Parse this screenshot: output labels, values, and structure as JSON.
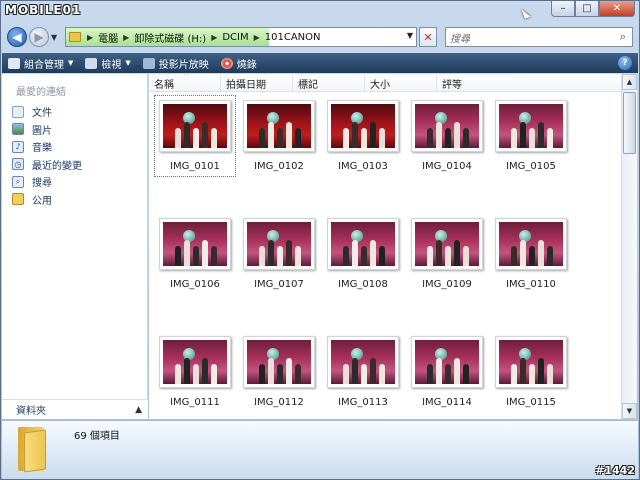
{
  "window": {
    "logo_text": "MOBILE01",
    "minimize_symbol": "–",
    "maximize_symbol": "□",
    "close_symbol": "✕"
  },
  "address": {
    "crumbs": [
      "電腦",
      "卸除式磁碟 (H:)",
      "DCIM",
      "101CANON"
    ],
    "search_placeholder": "搜尋",
    "back_symbol": "◀",
    "forward_symbol": "▶"
  },
  "toolbar": {
    "organize_label": "組合管理",
    "views_label": "檢視",
    "slideshow_label": "投影片放映",
    "burn_label": "燒錄",
    "help_symbol": "?"
  },
  "nav_pane": {
    "title": "最愛的連結",
    "items": [
      {
        "label": "文件",
        "icon": "documents-icon"
      },
      {
        "label": "圖片",
        "icon": "pictures-icon"
      },
      {
        "label": "音樂",
        "icon": "music-icon"
      },
      {
        "label": "最近的變更",
        "icon": "recent-changes-icon"
      },
      {
        "label": "搜尋",
        "icon": "searches-icon"
      },
      {
        "label": "公用",
        "icon": "public-folder-icon"
      }
    ],
    "folders_label": "資料夾"
  },
  "columns": [
    "名稱",
    "拍攝日期",
    "標記",
    "大小",
    "評等"
  ],
  "files": [
    {
      "name": "IMG_0101",
      "tone": "red",
      "selected": true
    },
    {
      "name": "IMG_0102",
      "tone": "red"
    },
    {
      "name": "IMG_0103",
      "tone": "red"
    },
    {
      "name": "IMG_0104",
      "tone": "purple"
    },
    {
      "name": "IMG_0105",
      "tone": "purple"
    },
    {
      "name": "IMG_0106",
      "tone": "purple"
    },
    {
      "name": "IMG_0107",
      "tone": "purple"
    },
    {
      "name": "IMG_0108",
      "tone": "purple"
    },
    {
      "name": "IMG_0109",
      "tone": "purple"
    },
    {
      "name": "IMG_0110",
      "tone": "purple"
    },
    {
      "name": "IMG_0111",
      "tone": "purple"
    },
    {
      "name": "IMG_0112",
      "tone": "purple"
    },
    {
      "name": "IMG_0113",
      "tone": "purple"
    },
    {
      "name": "IMG_0114",
      "tone": "purple"
    },
    {
      "name": "IMG_0115",
      "tone": "purple"
    }
  ],
  "details": {
    "item_count": "69 個項目"
  },
  "corner_watermark": "#1442",
  "colors": {
    "toolbar_bg": "#1e3b5a",
    "nav_link": "#1d3c66",
    "address_progress": "#a8e28b"
  }
}
